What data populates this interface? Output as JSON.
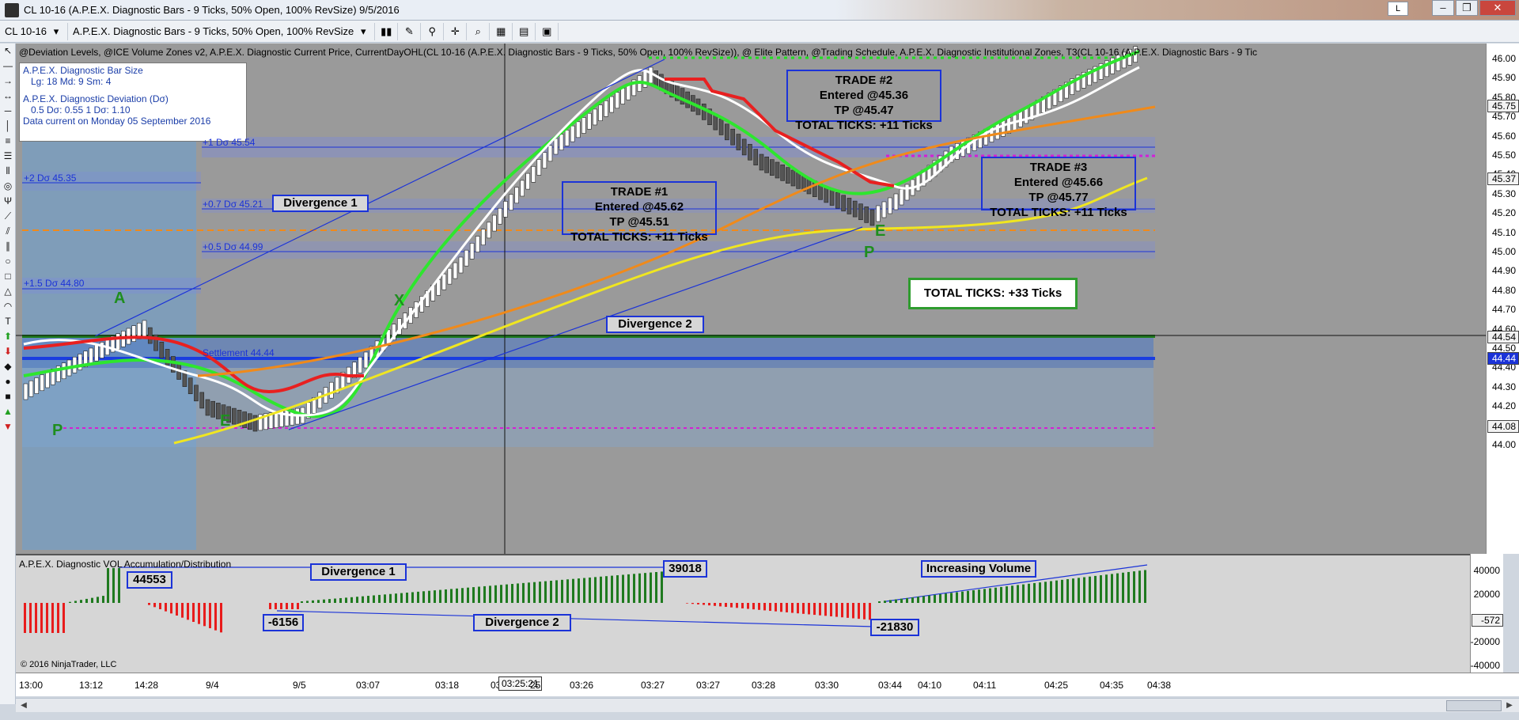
{
  "window": {
    "title": "CL 10-16 (A.P.E.X. Diagnostic Bars - 9 Ticks, 50% Open, 100% RevSize)  9/5/2016",
    "layout_button": "L",
    "minimize": "–",
    "restore": "❐",
    "close": "✕"
  },
  "toolbar": {
    "instrument": "CL 10-16",
    "bar_type": "A.P.E.X. Diagnostic Bars - 9 Ticks, 50% Open, 100% RevSize"
  },
  "chart": {
    "indicators": "@Deviation Levels, @ICE Volume Zones v2, A.P.E.X. Diagnostic Current Price, CurrentDayOHL(CL 10-16 (A.P.E.X. Diagnostic Bars - 9 Ticks, 50% Open, 100% RevSize)), @ Elite Pattern, @Trading Schedule, A.P.E.X. Diagnostic Institutional Zones, T3(CL 10-16 (A.P.E.X. Diagnostic Bars - 9 Tic",
    "info": {
      "line1": "A.P.E.X. Diagnostic Bar Size",
      "line2": "Lg: 18   Md: 9   Sm: 4",
      "line3": "A.P.E.X. Diagnostic Deviation (Dσ)",
      "line4": "0.5 Dσ: 0.55   1   Dσ: 1.10",
      "line5": "Data current on Monday 05 September 2016"
    },
    "levels": {
      "p1": "+1 Dσ 45.54",
      "p2": "+2 Dσ 45.35",
      "p07": "+0.7 Dσ 45.21",
      "p05": "+0.5 Dσ 44.99",
      "p15": "+1.5 Dσ 44.80",
      "settlement": "Settlement 44.44"
    },
    "annotations": {
      "divergence1": "Divergence 1",
      "divergence2": "Divergence 2",
      "trade1": [
        "TRADE #1",
        "Entered @45.62",
        "TP @45.51",
        "TOTAL TICKS: +11 Ticks"
      ],
      "trade2": [
        "TRADE #2",
        "Entered @45.36",
        "TP @45.47",
        "TOTAL TICKS: +11 Ticks"
      ],
      "trade3": [
        "TRADE #3",
        "Entered @45.66",
        "TP @45.77",
        "TOTAL TICKS: +11 Ticks"
      ],
      "total": "TOTAL TICKS: +33 Ticks"
    },
    "markers": {
      "A": "A",
      "X": "X",
      "E": "E",
      "P": "P"
    },
    "price_axis": [
      "46.00",
      "45.90",
      "45.80",
      "45.70",
      "45.60",
      "45.50",
      "45.40",
      "45.30",
      "45.20",
      "45.10",
      "45.00",
      "44.90",
      "44.80",
      "44.70",
      "44.60",
      "44.50",
      "44.40",
      "44.30",
      "44.20",
      "44.10",
      "44.00"
    ],
    "price_boxes": {
      "high": "45.75",
      "mid": "45.37",
      "cur": "44.54",
      "settle": "44.44",
      "low": "44.08"
    }
  },
  "volume": {
    "label": "A.P.E.X. Diagnostic VOL Accumulation/Distribution",
    "copyright": "© 2016 NinjaTrader, LLC",
    "tags": {
      "v1": "44553",
      "v2": "-6156",
      "v3": "39018",
      "v4": "-21830",
      "div1": "Divergence 1",
      "div2": "Divergence 2",
      "incr": "Increasing Volume"
    },
    "axis": [
      "40000",
      "20000",
      "-20000",
      "-40000"
    ],
    "axis_box": "-572"
  },
  "time_axis": {
    "labels": [
      "13:00",
      "13:12",
      "14:28",
      "9/4",
      "9/5",
      "03:07",
      "03:18",
      "03:23",
      "03:25:21",
      "25",
      "03:26",
      "03:27",
      "03:27",
      "03:28",
      "03:30",
      "03:44",
      "04:10",
      "04:11",
      "04:25",
      "04:35",
      "04:38"
    ]
  }
}
